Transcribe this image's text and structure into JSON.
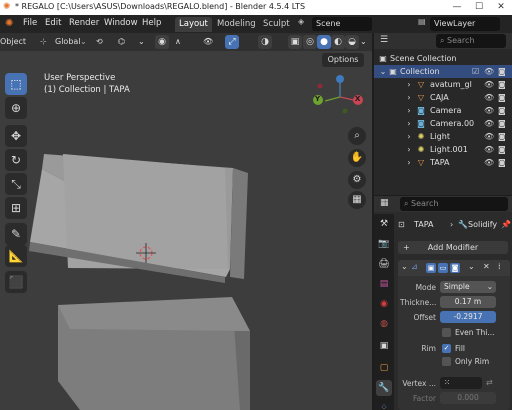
{
  "window": {
    "title": "* REGALO [C:\\Users\\ASUS\\Downloads\\REGALO.blend] - Blender 4.5.4 LTS",
    "controls": [
      "—",
      "☐",
      "✕"
    ]
  },
  "menubar": {
    "items": [
      "File",
      "Edit",
      "Render",
      "Window",
      "Help"
    ],
    "tabs": [
      "Layout",
      "Modeling",
      "Sculpt"
    ],
    "active_tab": "Layout",
    "scene_label": "Scene",
    "viewlayer_label": "ViewLayer"
  },
  "viewport_header": {
    "mode": "Object",
    "transform_orientation": "Global",
    "options_label": "Options"
  },
  "viewport": {
    "perspective_label": "User Perspective",
    "collection_label": "(1) Collection | TAPA",
    "gizmo_labels": [
      "Y",
      "X",
      "Z"
    ]
  },
  "outliner": {
    "search_placeholder": "Search",
    "root": "Scene Collection",
    "collection": "Collection",
    "items": [
      {
        "name": "avatum_gl",
        "color": "#e8a04f"
      },
      {
        "name": "CAJA",
        "color": "#e8a04f"
      },
      {
        "name": "Camera",
        "color": "#6bb0d6"
      },
      {
        "name": "Camera.00",
        "color": "#6bb0d6"
      },
      {
        "name": "Light",
        "color": "#e0d46a"
      },
      {
        "name": "Light.001",
        "color": "#e0d46a"
      },
      {
        "name": "TAPA",
        "color": "#e8a04f"
      }
    ]
  },
  "properties": {
    "search_placeholder": "Search",
    "object_name": "TAPA",
    "modifier_tab": "Solidify",
    "add_modifier_label": "Add Modifier",
    "fields": {
      "mode_label": "Mode",
      "mode_value": "Simple",
      "thickness_label": "Thickne...",
      "thickness_value": "0.17 m",
      "offset_label": "Offset",
      "offset_value": "-0.2917",
      "even_thickness_label": "Even Thi...",
      "rim_label": "Rim",
      "fill_label": "Fill",
      "only_rim_label": "Only Rim",
      "vertex_label": "Vertex ...",
      "factor_label": "Factor",
      "factor_value": "0.000"
    }
  }
}
